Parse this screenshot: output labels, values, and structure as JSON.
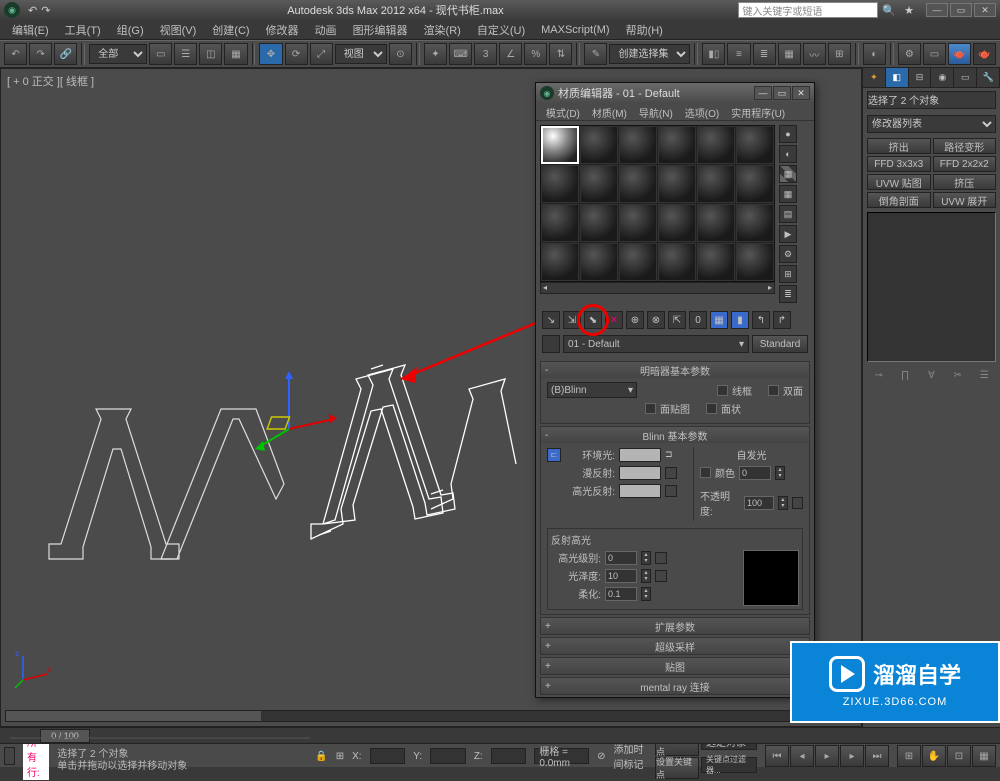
{
  "title_bar": {
    "app": "Autodesk 3ds Max  2012 x64",
    "doc": "现代书柜.max",
    "search_placeholder": "键入关键字或短语"
  },
  "menus": [
    "编辑(E)",
    "工具(T)",
    "组(G)",
    "视图(V)",
    "创建(C)",
    "修改器",
    "动画",
    "图形编辑器",
    "渲染(R)",
    "自定义(U)",
    "MAXScript(M)",
    "帮助(H)"
  ],
  "toolbar": {
    "scope": "全部",
    "view": "视图",
    "selset": "创建选择集"
  },
  "viewport": {
    "label": "[ + 0 正交 ][ 线框 ]"
  },
  "right_panel": {
    "selection": "选择了 2 个对象",
    "modlist": "修改器列表",
    "mods": [
      "挤出",
      "路径变形",
      "FFD 3x3x3",
      "FFD 2x2x2",
      "UVW 贴图",
      "挤压",
      "倒角剖面",
      "UVW 展开"
    ]
  },
  "mat": {
    "title": "材质编辑器 - 01 - Default",
    "menus": [
      "模式(D)",
      "材质(M)",
      "导航(N)",
      "选项(O)",
      "实用程序(U)"
    ],
    "slot_name": "01 - Default",
    "type_btn": "Standard",
    "r_basic": "明暗器基本参数",
    "shader": "(B)Blinn",
    "chk_wire": "线框",
    "chk_2side": "双面",
    "chk_facemap": "面贴图",
    "chk_faceted": "面状",
    "r_blinn": "Blinn 基本参数",
    "selfillum": "自发光",
    "color_lbl": "颜色",
    "ambient": "环境光:",
    "diffuse": "漫反射:",
    "specular": "高光反射:",
    "opacity": "不透明度:",
    "hl_group": "反射高光",
    "spec_level": "高光级别:",
    "gloss": "光泽度:",
    "soften": "柔化:",
    "selfillum_val": "0",
    "opacity_val": "100",
    "spec_level_val": "0",
    "gloss_val": "10",
    "soften_val": "0.1",
    "r_ext": "扩展参数",
    "r_ss": "超级采样",
    "r_maps": "贴图",
    "r_mr": "mental ray 连接"
  },
  "bottom": {
    "slider": "0 / 100",
    "sel_status": "选择了 2 个对象",
    "hint": "单击并拖动以选择并移动对象",
    "add_marker": "添加时间标记",
    "x": "X:",
    "y": "Y:",
    "z": "Z:",
    "grid": "栅格 = 0.0mm",
    "autokey": "自动关键点",
    "selset": "选定对象",
    "setkey": "设置关键点",
    "keyfilter": "关键点过滤器...",
    "listen": "所有行:"
  },
  "watermark": {
    "brand": "溜溜自学",
    "url": "ZIXUE.3D66.COM"
  }
}
